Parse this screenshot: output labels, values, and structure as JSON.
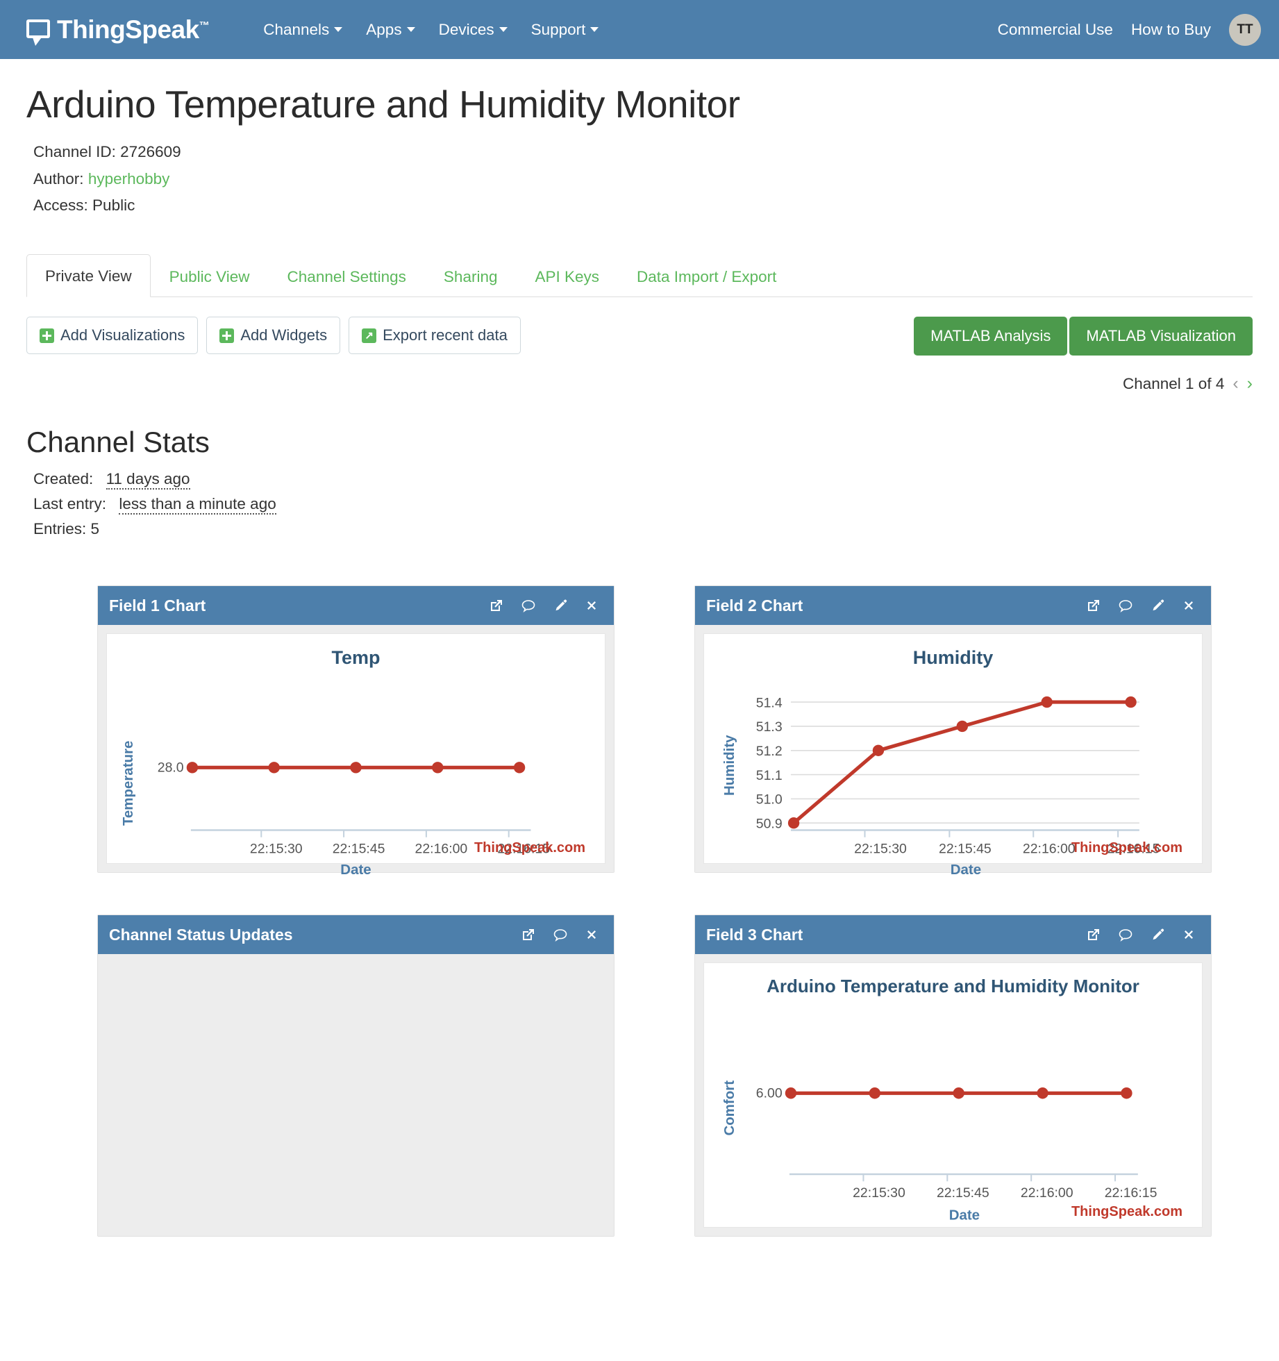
{
  "navbar": {
    "brand": "ThingSpeak",
    "brand_tm": "™",
    "menu": [
      {
        "label": "Channels"
      },
      {
        "label": "Apps"
      },
      {
        "label": "Devices"
      },
      {
        "label": "Support"
      }
    ],
    "right_links": [
      {
        "label": "Commercial Use"
      },
      {
        "label": "How to Buy"
      }
    ],
    "avatar_initials": "TT"
  },
  "header": {
    "title": "Arduino Temperature and Humidity Monitor",
    "channel_id_label": "Channel ID:",
    "channel_id": "2726609",
    "author_label": "Author:",
    "author": "hyperhobby",
    "access_label": "Access:",
    "access": "Public"
  },
  "tabs": [
    {
      "label": "Private View",
      "active": true
    },
    {
      "label": "Public View",
      "active": false
    },
    {
      "label": "Channel Settings",
      "active": false
    },
    {
      "label": "Sharing",
      "active": false
    },
    {
      "label": "API Keys",
      "active": false
    },
    {
      "label": "Data Import / Export",
      "active": false
    }
  ],
  "actions": {
    "add_visualizations": "Add Visualizations",
    "add_widgets": "Add Widgets",
    "export_recent_data": "Export recent data",
    "matlab_analysis": "MATLAB Analysis",
    "matlab_visualization": "MATLAB Visualization",
    "export_icon_glyph": "↗"
  },
  "pager": {
    "text": "Channel 1 of 4",
    "prev_glyph": "‹",
    "next_glyph": "›"
  },
  "channel_stats": {
    "heading": "Channel Stats",
    "created_label": "Created:",
    "created_value": "11 days ago",
    "last_entry_label": "Last entry:",
    "last_entry_value": "less than a minute ago",
    "entries_label": "Entries:",
    "entries_value": "5"
  },
  "widgets": [
    {
      "title": "Field 1 Chart",
      "icons": [
        "external-link-icon",
        "comment-icon",
        "pencil-icon",
        "close-icon"
      ]
    },
    {
      "title": "Field 2 Chart",
      "icons": [
        "external-link-icon",
        "comment-icon",
        "pencil-icon",
        "close-icon"
      ]
    },
    {
      "title": "Channel Status Updates",
      "icons": [
        "external-link-icon",
        "comment-icon",
        "close-icon"
      ]
    },
    {
      "title": "Field 3 Chart",
      "icons": [
        "external-link-icon",
        "comment-icon",
        "pencil-icon",
        "close-icon"
      ]
    }
  ],
  "credit": "ThingSpeak.com",
  "colors": {
    "navbar_blue": "#4d7fab",
    "widget_header_blue": "#4d7fab",
    "line_red": "#c0392b",
    "green": "#5cb85c",
    "matlab_green": "#4c9a4c",
    "axis_label_blue": "#4a7ba7",
    "chart_title_blue": "#2f5574"
  },
  "chart_data": [
    {
      "id": "field1",
      "type": "line",
      "title": "Temp",
      "xlabel": "Date",
      "ylabel": "Temperature",
      "x": [
        "22:15:22",
        "22:15:33",
        "22:15:49",
        "22:16:05",
        "22:16:22"
      ],
      "xticks": [
        "22:15:30",
        "22:15:45",
        "22:16:00",
        "22:16:15"
      ],
      "values": [
        28.0,
        28.0,
        28.0,
        28.0,
        28.0
      ],
      "yticks": [
        "28.0"
      ],
      "ylim": [
        28.0,
        28.0
      ],
      "grid": false,
      "legend": "none",
      "credit": "ThingSpeak.com"
    },
    {
      "id": "field2",
      "type": "line",
      "title": "Humidity",
      "xlabel": "Date",
      "ylabel": "Humidity",
      "x": [
        "22:15:22",
        "22:15:33",
        "22:15:49",
        "22:16:05",
        "22:16:22"
      ],
      "xticks": [
        "22:15:30",
        "22:15:45",
        "22:16:00",
        "22:16:15"
      ],
      "values": [
        50.9,
        51.2,
        51.3,
        51.4,
        51.4
      ],
      "yticks": [
        "50.9",
        "51.0",
        "51.1",
        "51.2",
        "51.3",
        "51.4"
      ],
      "ylim": [
        50.9,
        51.4
      ],
      "grid": true,
      "legend": "none",
      "credit": "ThingSpeak.com"
    },
    {
      "id": "field3",
      "type": "line",
      "title": "Arduino Temperature and Humidity Monitor",
      "xlabel": "Date",
      "ylabel": "Comfort",
      "x": [
        "22:15:22",
        "22:15:33",
        "22:15:49",
        "22:16:05",
        "22:16:22"
      ],
      "xticks": [
        "22:15:30",
        "22:15:45",
        "22:16:00",
        "22:16:15"
      ],
      "values": [
        6.0,
        6.0,
        6.0,
        6.0,
        6.0
      ],
      "yticks": [
        "6.00"
      ],
      "ylim": [
        6.0,
        6.0
      ],
      "grid": false,
      "legend": "none",
      "credit": "ThingSpeak.com"
    }
  ]
}
